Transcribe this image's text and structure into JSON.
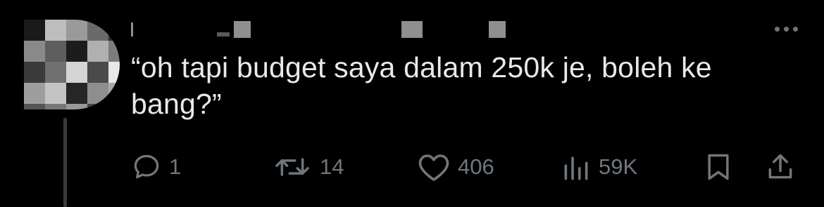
{
  "tweet": {
    "text": "“oh tapi budget saya dalam 250k je, boleh ke bang?”",
    "actions": {
      "reply_count": "1",
      "retweet_count": "14",
      "like_count": "406",
      "view_count": "59K"
    }
  },
  "icons": {
    "more": "more-horizontal-icon",
    "reply": "reply-bubble-icon",
    "retweet": "retweet-arrows-icon",
    "like": "heart-icon",
    "views": "bar-chart-icon",
    "bookmark": "bookmark-icon",
    "share": "share-upload-icon"
  },
  "colors": {
    "background": "#000000",
    "text": "#e7e9ea",
    "muted": "#71767b",
    "censor": "#8f8f8f"
  }
}
